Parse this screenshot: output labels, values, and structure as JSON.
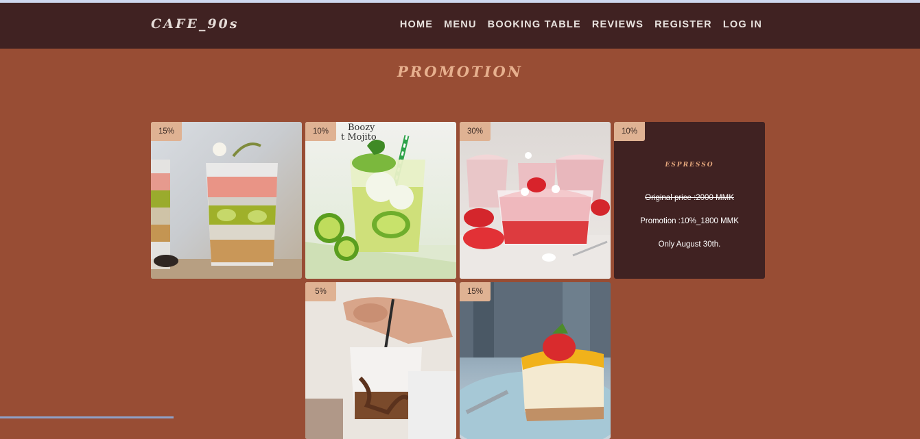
{
  "brand": {
    "logo": "CAFE_90s"
  },
  "nav": {
    "items": [
      "HOME",
      "MENU",
      "BOOKING TABLE",
      "REVIEWS",
      "REGISTER",
      "LOG IN"
    ]
  },
  "promotion": {
    "title": "PROMOTION",
    "cards": [
      {
        "badge": "15%",
        "image": "chia-kiwi-parfait-photo"
      },
      {
        "badge": "10%",
        "image": "mojito-photo"
      },
      {
        "badge": "30%",
        "image": "strawberry-mousse-photo"
      },
      {
        "badge": "5%",
        "image": "iced-coffee-photo"
      },
      {
        "badge": "15%",
        "image": "mango-cheesecake-photo"
      }
    ],
    "featured": {
      "badge": "10%",
      "name": "ESPRESSO",
      "original_price": "Original price :2000 MMK",
      "promotion": "Promotion :10%_1800 MMK",
      "validity": "Only August 30th."
    }
  },
  "colors": {
    "background": "#984d34",
    "navbar": "#402222",
    "badge": "#dfb293",
    "title": "#e7b08e"
  }
}
